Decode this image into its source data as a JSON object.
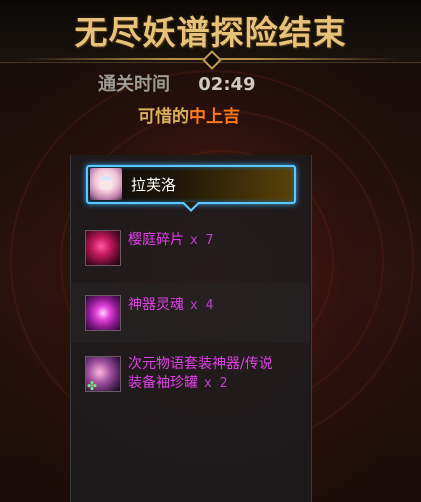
{
  "title": "无尽妖谱探险结束",
  "clear_time": {
    "label": "通关时间",
    "value": "02:49"
  },
  "result": {
    "prefix": "可惜的",
    "grade": "中上吉"
  },
  "character": {
    "name": "拉芙洛",
    "icon": "character-portrait"
  },
  "rewards": [
    {
      "name": "樱庭碎片",
      "qty": "x 7",
      "icon": "sakura-shard-icon"
    },
    {
      "name": "神器灵魂",
      "qty": "x 4",
      "icon": "artifact-soul-icon"
    },
    {
      "name_line1": "次元物语套装神器/传说",
      "name_line2": "装备袖珍罐",
      "qty": "x 2",
      "icon": "pocket-jar-icon"
    }
  ],
  "colors": {
    "title_gold": "#e6c27a",
    "grade_orange": "#ff7a1a",
    "item_purple": "#e040e8",
    "selection_blue": "#5cc8ff"
  }
}
